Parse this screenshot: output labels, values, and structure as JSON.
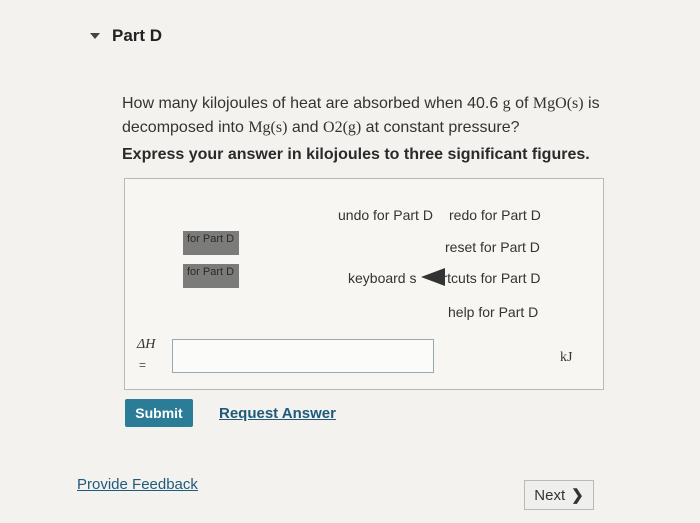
{
  "header": {
    "title": "Part D"
  },
  "question": {
    "p1": "How many kilojoules of heat are absorbed when 40.6 ",
    "g": "g",
    "p2": " of ",
    "mgo": "MgO(s)",
    "p3": " is",
    "p4": "decomposed into ",
    "mg": "Mg(s)",
    "p5": " and ",
    "o2": "O2(g)",
    "p6": " at constant pressure?"
  },
  "instruction": "Express your answer in kilojoules to three significant figures.",
  "toolbar": {
    "undo": "undo for Part D",
    "redo": "redo for Part D",
    "reset": "reset for Part D",
    "keyboard_prefix": "keyboard s",
    "keyboard_suffix": "rtcuts for Part D",
    "help": "help for Part D",
    "btn1": "for Part D",
    "btn2": "for Part D"
  },
  "answer": {
    "label": "ΔH",
    "equals": "=",
    "value": "",
    "unit": "kJ"
  },
  "actions": {
    "submit": "Submit",
    "request": "Request Answer"
  },
  "footer": {
    "feedback": "Provide Feedback",
    "next": "Next"
  }
}
